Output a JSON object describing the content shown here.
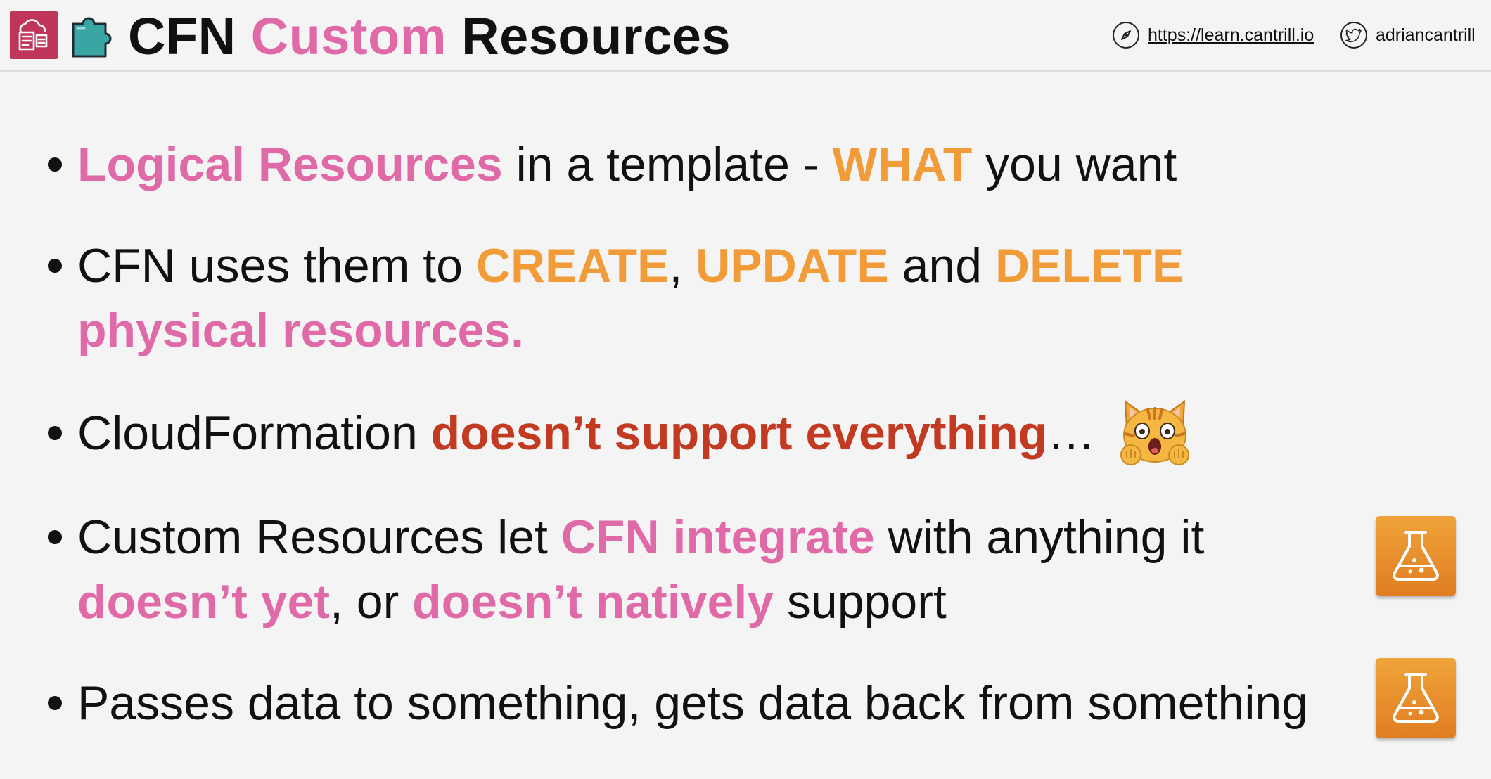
{
  "header": {
    "title_part1": "CFN",
    "title_part2": "Custom",
    "title_part3": "Resources",
    "link_text": "https://learn.cantrill.io",
    "twitter_handle": "adriancantrill"
  },
  "bullets": [
    {
      "segments": [
        {
          "text": "Logical Resources",
          "style": "pink"
        },
        {
          "text": " in a template - ",
          "style": "plain"
        },
        {
          "text": "WHAT",
          "style": "orange"
        },
        {
          "text": " you want",
          "style": "plain"
        }
      ]
    },
    {
      "segments": [
        {
          "text": "CFN uses them to ",
          "style": "plain"
        },
        {
          "text": "CREATE",
          "style": "orange"
        },
        {
          "text": ", ",
          "style": "plain"
        },
        {
          "text": "UPDATE",
          "style": "orange"
        },
        {
          "text": " and ",
          "style": "plain"
        },
        {
          "text": "DELETE",
          "style": "orange"
        },
        {
          "text": " physical resources.",
          "style": "pink"
        }
      ]
    },
    {
      "segments": [
        {
          "text": "CloudFormation ",
          "style": "plain"
        },
        {
          "text": "doesn’t support everything",
          "style": "red"
        },
        {
          "text": "…",
          "style": "plain"
        }
      ]
    },
    {
      "segments": [
        {
          "text": "Custom Resources let ",
          "style": "plain"
        },
        {
          "text": "CFN integrate",
          "style": "pink"
        },
        {
          "text": " with anything it ",
          "style": "plain"
        },
        {
          "text": "doesn’t yet",
          "style": "pink"
        },
        {
          "text": ", or ",
          "style": "plain"
        },
        {
          "text": "doesn’t natively",
          "style": "pink"
        },
        {
          "text": " support",
          "style": "plain"
        }
      ]
    },
    {
      "segments": [
        {
          "text": "Passes data to something, gets data back from something",
          "style": "plain"
        }
      ]
    }
  ],
  "colors": {
    "pink": "#e06aa8",
    "orange": "#f19c38",
    "red": "#c23a22",
    "logo_bg": "#c0365a",
    "lab_icon": "#ea8c2d"
  },
  "icons": [
    "aws-management-logo-icon",
    "puzzle-icon",
    "compass-icon",
    "twitter-bird-icon",
    "astonished-cat-emoji-icon",
    "lab-flask-icon"
  ]
}
